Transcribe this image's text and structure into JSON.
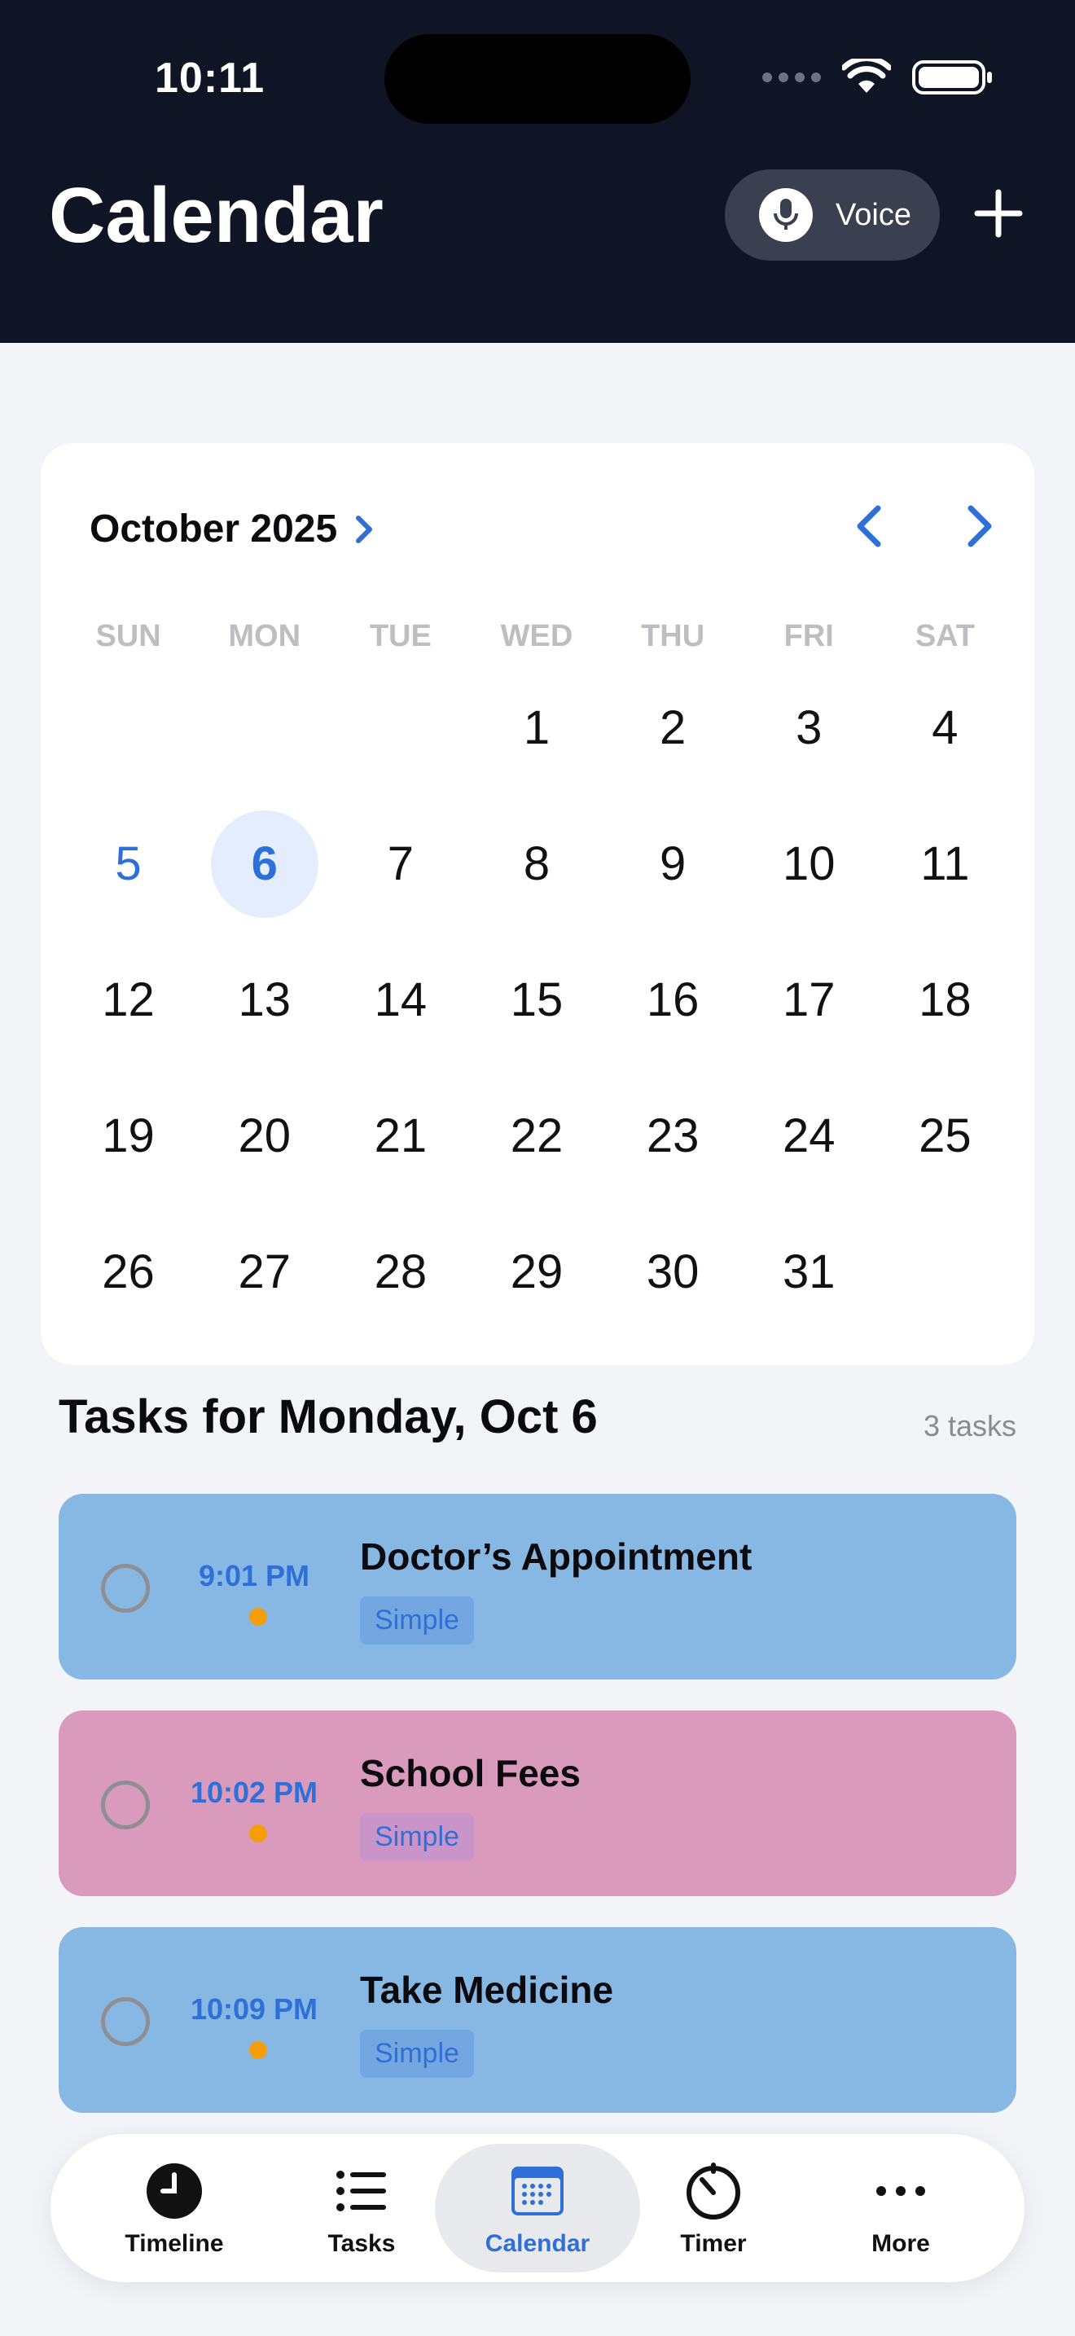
{
  "status": {
    "time": "10:11"
  },
  "header": {
    "title": "Calendar",
    "voice_label": "Voice"
  },
  "calendar": {
    "month_label": "October 2025",
    "weekdays": [
      "SUN",
      "MON",
      "TUE",
      "WED",
      "THU",
      "FRI",
      "SAT"
    ],
    "today_day": 5,
    "selected_day": 6,
    "days": [
      "",
      "",
      "",
      "1",
      "2",
      "3",
      "4",
      "5",
      "6",
      "7",
      "8",
      "9",
      "10",
      "11",
      "12",
      "13",
      "14",
      "15",
      "16",
      "17",
      "18",
      "19",
      "20",
      "21",
      "22",
      "23",
      "24",
      "25",
      "26",
      "27",
      "28",
      "29",
      "30",
      "31",
      ""
    ]
  },
  "tasks_section": {
    "title": "Tasks for Monday, Oct 6",
    "count_label": "3 tasks",
    "items": [
      {
        "time": "9:01 PM",
        "name": "Doctor’s Appointment",
        "tag": "Simple",
        "color": "#86B8E3",
        "tag_bg": "#74A7E0"
      },
      {
        "time": "10:02 PM",
        "name": "School Fees",
        "tag": "Simple",
        "color": "#D99ABC",
        "tag_bg": "#C994C8"
      },
      {
        "time": "10:09 PM",
        "name": "Take Medicine",
        "tag": "Simple",
        "color": "#86B8E3",
        "tag_bg": "#74A7E0"
      }
    ]
  },
  "tabbar": {
    "items": [
      {
        "label": "Timeline",
        "icon": "clock-icon"
      },
      {
        "label": "Tasks",
        "icon": "list-icon"
      },
      {
        "label": "Calendar",
        "icon": "calendar-icon",
        "active": true
      },
      {
        "label": "Timer",
        "icon": "timer-icon"
      },
      {
        "label": "More",
        "icon": "more-icon"
      }
    ]
  },
  "colors": {
    "accent": "#2F6FD8",
    "header_bg": "#0F1525",
    "dot": "#F59E0B"
  }
}
